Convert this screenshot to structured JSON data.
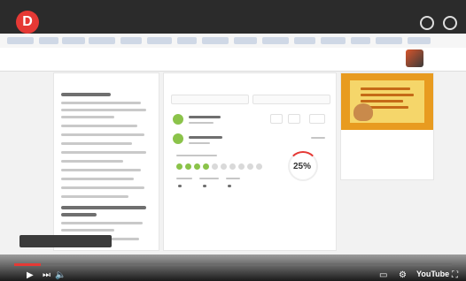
{
  "player": {
    "title": "",
    "time": "",
    "brand": "YouTube",
    "progress_fraction": 0.06
  },
  "app": {
    "breadcrumb": "",
    "breadcrumb_sub": "",
    "user_name": ""
  },
  "left_panel": {
    "title": ""
  },
  "mid_panel": {
    "title": "",
    "percent": "25%"
  },
  "course": {
    "name": "",
    "subtitle": "",
    "subtitle2": ""
  },
  "tooltip": {
    "text": ""
  },
  "colors": {
    "accent": "#e53935",
    "course_bg": "#e89b20",
    "progress_green": "#8bc34a"
  }
}
